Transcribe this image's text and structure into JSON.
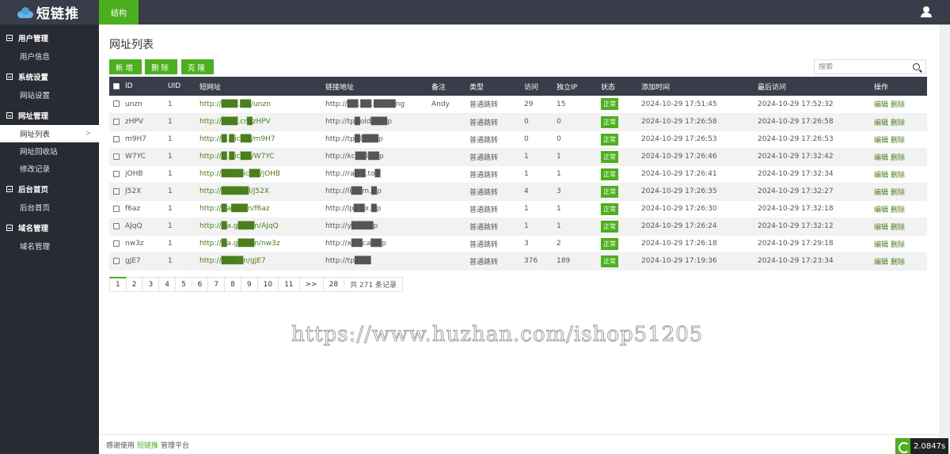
{
  "header": {
    "logo_text": "短链推",
    "tab_label": "结构"
  },
  "sidebar": {
    "groups": [
      {
        "label": "用户管理",
        "items": [
          "用户信息"
        ]
      },
      {
        "label": "系统设置",
        "items": [
          "网站设置"
        ]
      },
      {
        "label": "网址管理",
        "items": [
          "网址列表",
          "网址回收站",
          "修改记录"
        ]
      },
      {
        "label": "后台首页",
        "items": [
          "后台首页"
        ]
      },
      {
        "label": "域名管理",
        "items": [
          "域名管理"
        ]
      }
    ],
    "active_item": "网址列表"
  },
  "main": {
    "title": "网址列表",
    "buttons": {
      "add": "新增",
      "delete": "删除",
      "clone": "克隆"
    },
    "search_placeholder": "搜索"
  },
  "table": {
    "headers": [
      "ID",
      "UID",
      "短网址",
      "链接地址",
      "备注",
      "类型",
      "访问",
      "独立IP",
      "状态",
      "添加时间",
      "最后访问",
      "操作"
    ],
    "rows": [
      {
        "id": "unzn",
        "uid": "1",
        "short": "http://███.██/unzn",
        "target": "http://██.██.████ng",
        "note": "Andy",
        "type": "普通跳转",
        "visits": "29",
        "ip": "15",
        "status": "正常",
        "added": "2024-10-29 17:51:45",
        "last": "2024-10-29 17:52:32"
      },
      {
        "id": "zHPV",
        "uid": "1",
        "short": "http://███.cr█zHPV",
        "target": "http://tp█old███p",
        "note": "",
        "type": "普通跳转",
        "visits": "0",
        "ip": "0",
        "status": "正常",
        "added": "2024-10-29 17:26:58",
        "last": "2024-10-29 17:26:58"
      },
      {
        "id": "m9H7",
        "uid": "1",
        "short": "http://█.█ic██/m9H7",
        "target": "http://tp█l███p",
        "note": "",
        "type": "普通跳转",
        "visits": "0",
        "ip": "0",
        "status": "正常",
        "added": "2024-10-29 17:26:53",
        "last": "2024-10-29 17:26:53"
      },
      {
        "id": "W7YC",
        "uid": "1",
        "short": "http://█.█ic██/W7YC",
        "target": "http://kc██l██p",
        "note": "",
        "type": "普通跳转",
        "visits": "1",
        "ip": "1",
        "status": "正常",
        "added": "2024-10-29 17:26:46",
        "last": "2024-10-29 17:32:42"
      },
      {
        "id": "jOHB",
        "uid": "1",
        "short": "http://████ic██/jOHB",
        "target": "http://ra██.to█",
        "note": "",
        "type": "普通跳转",
        "visits": "1",
        "ip": "1",
        "status": "正常",
        "added": "2024-10-29 17:26:41",
        "last": "2024-10-29 17:32:34"
      },
      {
        "id": "J52X",
        "uid": "1",
        "short": "http://█████l/J52X",
        "target": "http://li██m.█p",
        "note": "",
        "type": "普通跳转",
        "visits": "4",
        "ip": "3",
        "status": "正常",
        "added": "2024-10-29 17:26:35",
        "last": "2024-10-29 17:32:27"
      },
      {
        "id": "f6az",
        "uid": "1",
        "short": "http://█a███n/f6az",
        "target": "http://lp██x.█p",
        "note": "",
        "type": "普通跳转",
        "visits": "1",
        "ip": "1",
        "status": "正常",
        "added": "2024-10-29 17:26:30",
        "last": "2024-10-29 17:32:18"
      },
      {
        "id": "AJqQ",
        "uid": "1",
        "short": "http://█a.g███n/AJqQ",
        "target": "http://y████p",
        "note": "",
        "type": "普通跳转",
        "visits": "1",
        "ip": "1",
        "status": "正常",
        "added": "2024-10-29 17:26:24",
        "last": "2024-10-29 17:32:12"
      },
      {
        "id": "nw3z",
        "uid": "1",
        "short": "http://█a.g███n/nw3z",
        "target": "http://x██ca██p",
        "note": "",
        "type": "普通跳转",
        "visits": "3",
        "ip": "2",
        "status": "正常",
        "added": "2024-10-29 17:26:18",
        "last": "2024-10-29 17:29:18"
      },
      {
        "id": "gJE7",
        "uid": "1",
        "short": "http://████n/gJE7",
        "target": "http://tp███",
        "note": "",
        "type": "普通跳转",
        "visits": "376",
        "ip": "189",
        "status": "正常",
        "added": "2024-10-29 17:19:36",
        "last": "2024-10-29 17:23:34"
      }
    ],
    "op_edit": "编辑",
    "op_delete": "删除"
  },
  "pagination": {
    "pages": [
      "1",
      "2",
      "3",
      "4",
      "5",
      "6",
      "7",
      "8",
      "9",
      "10",
      "11",
      ">>",
      "28"
    ],
    "current": "1",
    "total": "共 271 条记录"
  },
  "watermark": "https://www.huzhan.com/ishop51205",
  "footer": {
    "prefix": "感谢使用",
    "brand": "短链推",
    "suffix": "管理平台",
    "timing": "2.0847s"
  },
  "colors": {
    "accent": "#4caf1e",
    "topbar": "#393d49",
    "sidebar": "#282b33"
  }
}
